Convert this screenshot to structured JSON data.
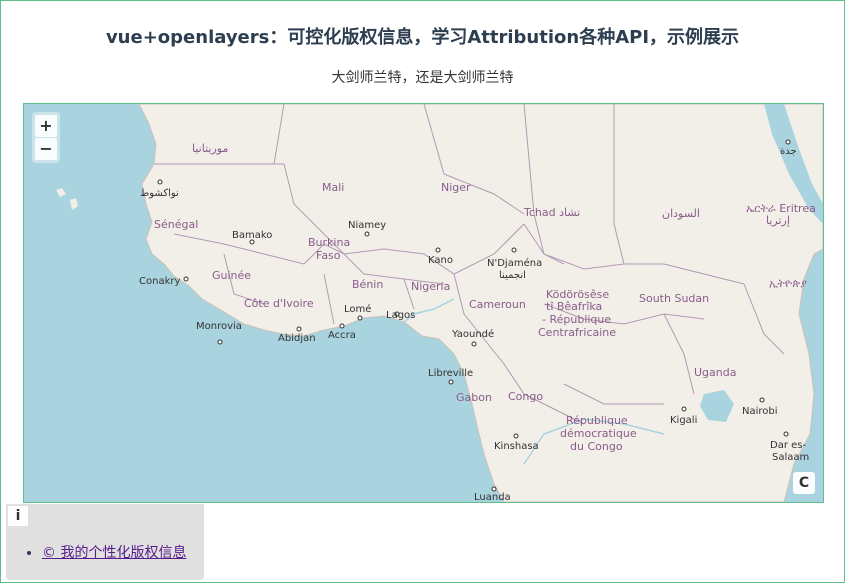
{
  "header": {
    "title": "vue+openlayers：可控化版权信息，学习Attribution各种API，示例展示",
    "subtitle": "大剑师兰特，还是大剑师兰特"
  },
  "map": {
    "zoom_in_label": "+",
    "zoom_out_label": "−",
    "attribution_toggle_label": "C",
    "country_labels": {
      "mauritania": "موريتانيا",
      "mali": "Mali",
      "niger": "Niger",
      "chad": "Tchad تشاد",
      "sudan": "السودان",
      "eritrea": "ኤርትራ Eritrea",
      "eritrea2": "إرتريا",
      "senegal": "Sénégal",
      "burkina": "Burkina",
      "faso": "Faso",
      "guinee": "Guinée",
      "benin": "Bénin",
      "nigeria": "Nigeria",
      "cote_ivoire": "Côte d'Ivoire",
      "cameroun": "Cameroun",
      "car1": "Ködörösêse",
      "car2": "tî Bêafrîka",
      "car3": "- République",
      "car4": "Centrafricaine",
      "south_sudan": "South Sudan",
      "ethiopia": "ኢትዮጵያ",
      "gabon": "Gabon",
      "congo": "Congo",
      "drc1": "République",
      "drc2": "démocratique",
      "drc3": "du Congo",
      "uganda": "Uganda"
    },
    "city_labels": {
      "nouakchott": "نواكشوط",
      "bamako": "Bamako",
      "niamey": "Niamey",
      "conakry": "Conakry",
      "kano": "Kano",
      "ndjamena": "N'Djaména",
      "ndjamena_ar": "انجمينا",
      "jeddah": "جدة",
      "monrovia": "Monrovia",
      "abidjan": "Abidjan",
      "accra": "Accra",
      "lome": "Lomé",
      "lagos": "Lagos",
      "yaounde": "Yaoundé",
      "libreville": "Libreville",
      "kinshasa": "Kinshasa",
      "kigali": "Kigali",
      "nairobi": "Nairobi",
      "dar1": "Dar es-",
      "dar2": "Salaam",
      "luanda": "Luanda"
    },
    "colors": {
      "ocean": "#a9d3df",
      "land": "#f2efe9",
      "border": "#b399b3",
      "accent_border": "#5fc08e"
    }
  },
  "attribution": {
    "info_button_label": "i",
    "items": [
      {
        "text": "© 我的个性化版权信息"
      }
    ]
  }
}
